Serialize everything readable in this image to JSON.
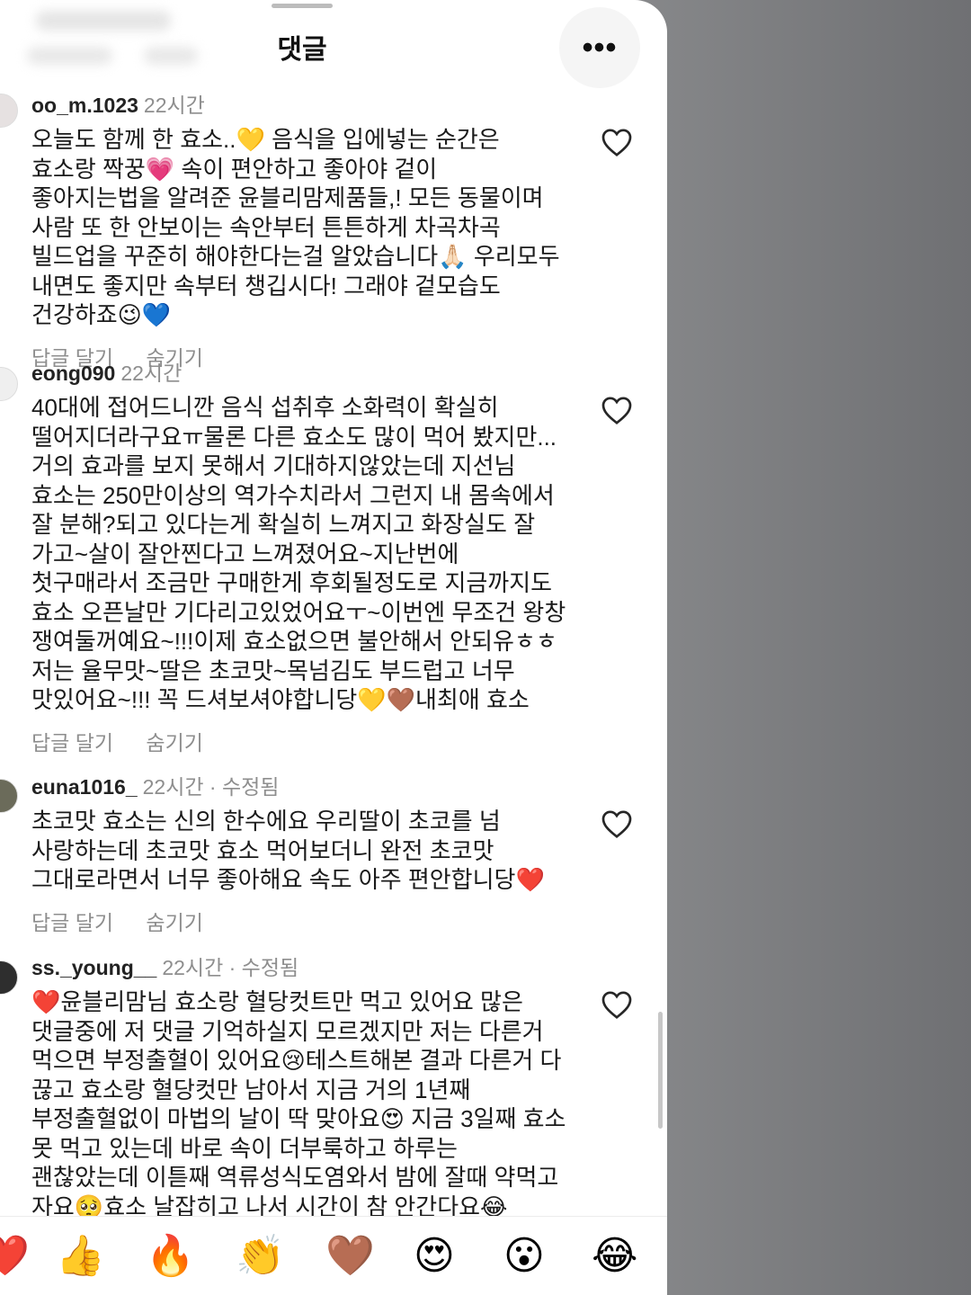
{
  "header": {
    "title": "댓글",
    "more_label": "•••"
  },
  "comments": [
    {
      "username": "oo_m.1023",
      "meta": "22시간",
      "text": "오늘도 함께 한 효소..💛 음식을 입에넣는 순간은 효소랑 짝꿍💗 속이 편안하고 좋아야 겉이 좋아지는법을 알려준 윤블리맘제품들,! 모든 동물이며 사람 또 한 안보이는 속안부터 튼튼하게 차곡차곡 빌드업을 꾸준히 해야한다는걸 알았습니다🙏🏻 우리모두 내면도 좋지만 속부터 챙깁시다! 그래야 겉모습도 건강하죠😉💙",
      "reply_label": "답글 달기",
      "hide_label": "숨기기"
    },
    {
      "username": "eong090",
      "meta": "22시간",
      "text": "40대에 접어드니깐 음식 섭취후 소화력이 확실히 떨어지더라구요ㅠ물론 다른 효소도 많이 먹어 봤지만... 거의 효과를 보지 못해서 기대하지않았는데 지선님 효소는 250만이상의 역가수치라서 그런지 내 몸속에서 잘 분해?되고 있다는게 확실히 느껴지고 화장실도 잘 가고~살이 잘안찐다고 느껴졌어요~지난번에 첫구매라서 조금만 구매한게 후회될정도로 지금까지도 효소 오픈날만 기다리고있었어요ㅜ~이번엔 무조건 왕창 쟁여둘꺼예요~!!!이제 효소없으면 불안해서 안되유ㅎㅎ 저는 율무맛~딸은 초코맛~목넘김도 부드럽고 너무 맛있어요~!!! 꼭 드셔보셔야합니당💛🤎내최애 효소",
      "reply_label": "답글 달기",
      "hide_label": "숨기기"
    },
    {
      "username": "euna1016_",
      "meta": "22시간 · 수정됨",
      "text": "초코맛 효소는 신의 한수에요 우리딸이 초코를 넘 사랑하는데 초코맛 효소 먹어보더니 완전 초코맛 그대로라면서 너무 좋아해요 속도 아주 편안합니당❤️",
      "reply_label": "답글 달기",
      "hide_label": "숨기기"
    },
    {
      "username": "ss._young__",
      "meta": "22시간 · 수정됨",
      "text": "❤️윤블리맘님 효소랑 혈당컷트만 먹고 있어요 많은 댓글중에 저 댓글 기억하실지 모르겠지만 저는 다른거 먹으면 부정출혈이 있어요😢테스트해본 결과 다른거 다 끊고 효소랑 혈당컷만 남아서 지금 거의 1년째 부정출혈없이 마법의 날이 딱 맞아요😍 지금 3일째 효소 못 먹고 있는데 바로 속이 더부룩하고 하루는 괜찮았는데 이튿째 역류성식도염와서 밤에 잘때 약먹고 자요🥺효소 날잡히고 나서 시간이 참 안간다요😂"
    }
  ],
  "reactions": [
    "❤️",
    "👍",
    "🔥",
    "👏",
    "🤎",
    "😍",
    "😮",
    "😂"
  ]
}
